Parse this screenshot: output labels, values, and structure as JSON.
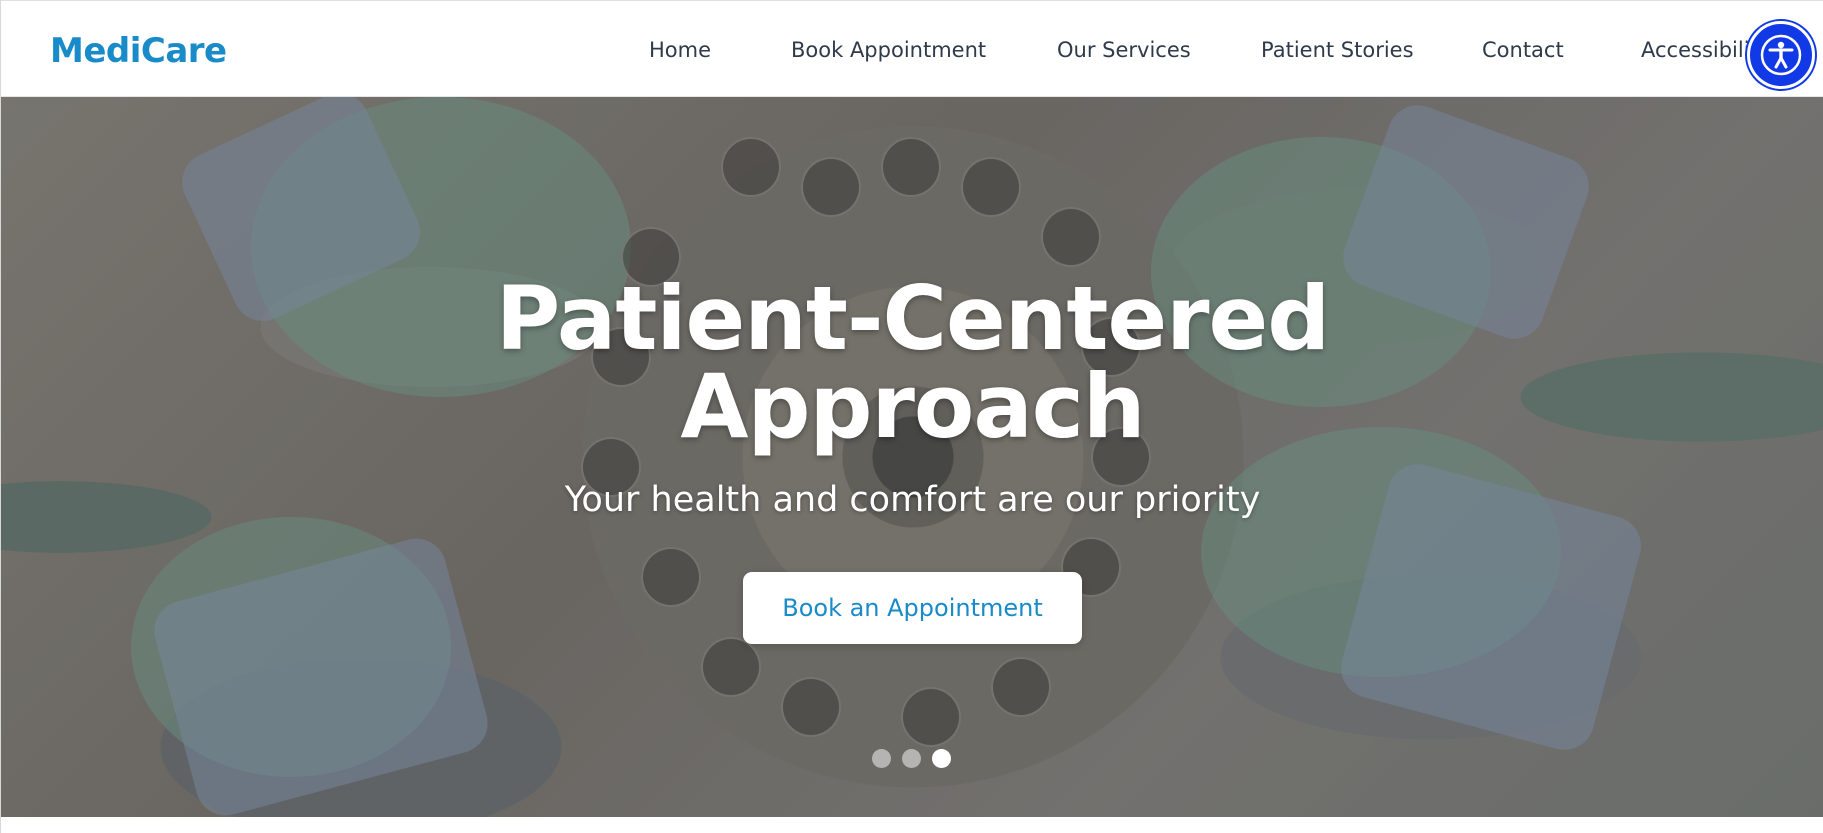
{
  "header": {
    "logo": "MediCare",
    "nav": {
      "home": "Home",
      "book": "Book Appointment",
      "services": "Our Services",
      "stories": "Patient Stories",
      "contact": "Contact",
      "accessibility": "Accessibility"
    },
    "accessibility_button_icon": "accessibility-person-icon"
  },
  "hero": {
    "title_line1": "Patient-Centered",
    "title_line2": "Approach",
    "subtitle": "Your health and comfort are our priority",
    "cta_label": "Book an Appointment",
    "slides_total": 3,
    "active_slide": 3
  },
  "colors": {
    "brand": "#1a8bc9",
    "nav_text": "#2f3a4a",
    "accessibility_button": "#1239e6"
  }
}
